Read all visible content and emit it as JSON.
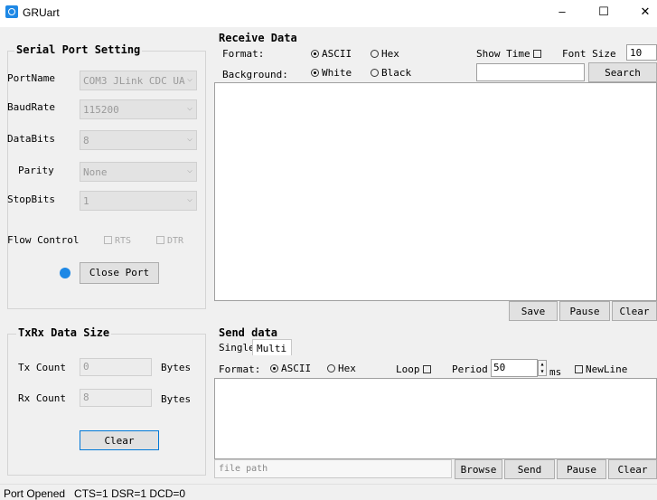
{
  "window": {
    "title": "GRUart",
    "minimize": "–",
    "maximize": "☐",
    "close": "✕"
  },
  "serial": {
    "title": "Serial Port Setting",
    "port_label": "PortName",
    "port_value": "COM3 JLink CDC UA",
    "baud_label": "BaudRate",
    "baud_value": "115200",
    "databits_label": "DataBits",
    "databits_value": "8",
    "parity_label": "Parity",
    "parity_value": "None",
    "stopbits_label": "StopBits",
    "stopbits_value": "1",
    "flow_label": "Flow Control",
    "rts_label": "RTS",
    "dtr_label": "DTR",
    "close_port": "Close Port",
    "status_color": "#1e88e5"
  },
  "txrx": {
    "title": "TxRx Data Size",
    "tx_label": "Tx Count",
    "tx_value": "0",
    "tx_unit": "Bytes",
    "rx_label": "Rx Count",
    "rx_value": "8",
    "rx_unit": "Bytes",
    "clear": "Clear"
  },
  "receive": {
    "title": "Receive Data",
    "format_label": "Format:",
    "ascii": "ASCII",
    "hex": "Hex",
    "show_time": "Show Time",
    "font_size_label": "Font Size",
    "font_size_value": "10",
    "background_label": "Background:",
    "white": "White",
    "black": "Black",
    "search": "Search",
    "save": "Save",
    "pause": "Pause",
    "clear": "Clear"
  },
  "send": {
    "title": "Send data",
    "tab_single": "Single",
    "tab_multi": "Multi",
    "format_label": "Format:",
    "ascii": "ASCII",
    "hex": "Hex",
    "loop": "Loop",
    "period_label": "Period",
    "period_value": "50",
    "ms": "ms",
    "newline": "NewLine",
    "file_path_placeholder": "file path",
    "browse": "Browse",
    "send": "Send",
    "pause": "Pause",
    "clear": "Clear"
  },
  "status": {
    "text": "Port Opened   CTS=1 DSR=1 DCD=0"
  }
}
